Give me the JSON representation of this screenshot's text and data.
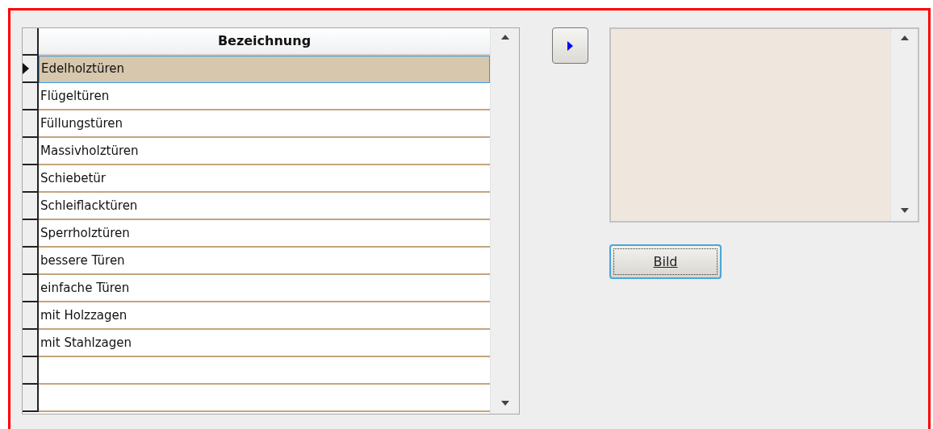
{
  "table": {
    "columns": [
      "Bezeichnung"
    ],
    "rows": [
      {
        "name": "Edelholztüren",
        "selected": true
      },
      {
        "name": "Flügeltüren",
        "selected": false
      },
      {
        "name": "Füllungstüren",
        "selected": false
      },
      {
        "name": "Massivholztüren",
        "selected": false
      },
      {
        "name": "Schiebetür",
        "selected": false
      },
      {
        "name": "Schleiflacktüren",
        "selected": false
      },
      {
        "name": "Sperrholztüren",
        "selected": false
      },
      {
        "name": "bessere Türen",
        "selected": false
      },
      {
        "name": "einfache Türen",
        "selected": false
      },
      {
        "name": "mit Holzzagen",
        "selected": false
      },
      {
        "name": "mit Stahlzagen",
        "selected": false
      }
    ]
  },
  "image_button": {
    "label": "Bild"
  }
}
